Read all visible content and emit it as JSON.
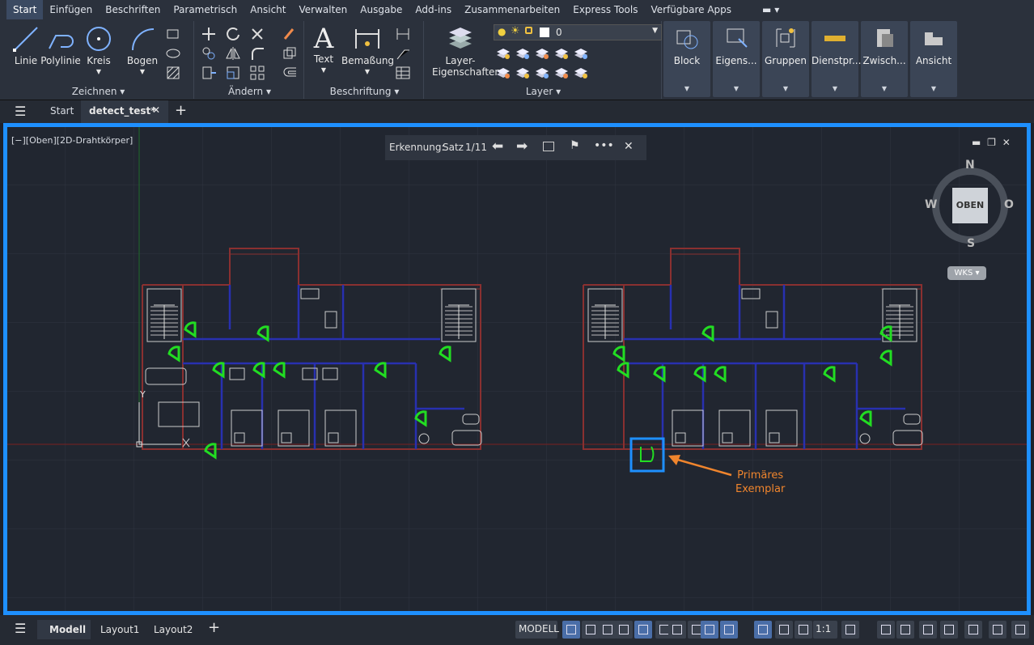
{
  "menubar": {
    "items": [
      "Start",
      "Einfügen",
      "Beschriften",
      "Parametrisch",
      "Ansicht",
      "Verwalten",
      "Ausgabe",
      "Add-ins",
      "Zusammenarbeiten",
      "Express Tools",
      "Verfügbare Apps"
    ]
  },
  "ribbon": {
    "zeichnen": {
      "title": "Zeichnen",
      "linie": "Linie",
      "polylinie": "Polylinie",
      "kreis": "Kreis",
      "bogen": "Bogen"
    },
    "aendern": {
      "title": "Ändern"
    },
    "beschriftung": {
      "title": "Beschriftung",
      "text": "Text",
      "bemassung": "Bemaßung"
    },
    "layer": {
      "title": "Layer",
      "eigenschaften_l1": "Layer-",
      "eigenschaften_l2": "Eigenschaften",
      "current_layer": "0"
    },
    "dark_panels": [
      "Block",
      "Eigens...",
      "Gruppen",
      "Dienstpr...",
      "Zwisch...",
      "Ansicht"
    ]
  },
  "tabs": {
    "start": "Start",
    "active": "detect_test*"
  },
  "viewport": {
    "view_label": "[−][Oben][2D-Drahtkörper]",
    "detect_toolbar": {
      "label": "Erkennung:",
      "satz": "Satz",
      "counter": "1/11"
    },
    "viewcube": {
      "n": "N",
      "s": "S",
      "w": "W",
      "o": "O",
      "face": "OBEN",
      "wcs": "WKS"
    },
    "annotation": {
      "line1": "Primäres",
      "line2": "Exemplar",
      "color": "#f0852d"
    },
    "highlight_color": "#1e90ff",
    "door_color": "#22dd22"
  },
  "statusbar": {
    "modell_tab": "Modell",
    "layout1": "Layout1",
    "layout2": "Layout2",
    "modell_btn": "MODELL",
    "scale": "1:1"
  }
}
